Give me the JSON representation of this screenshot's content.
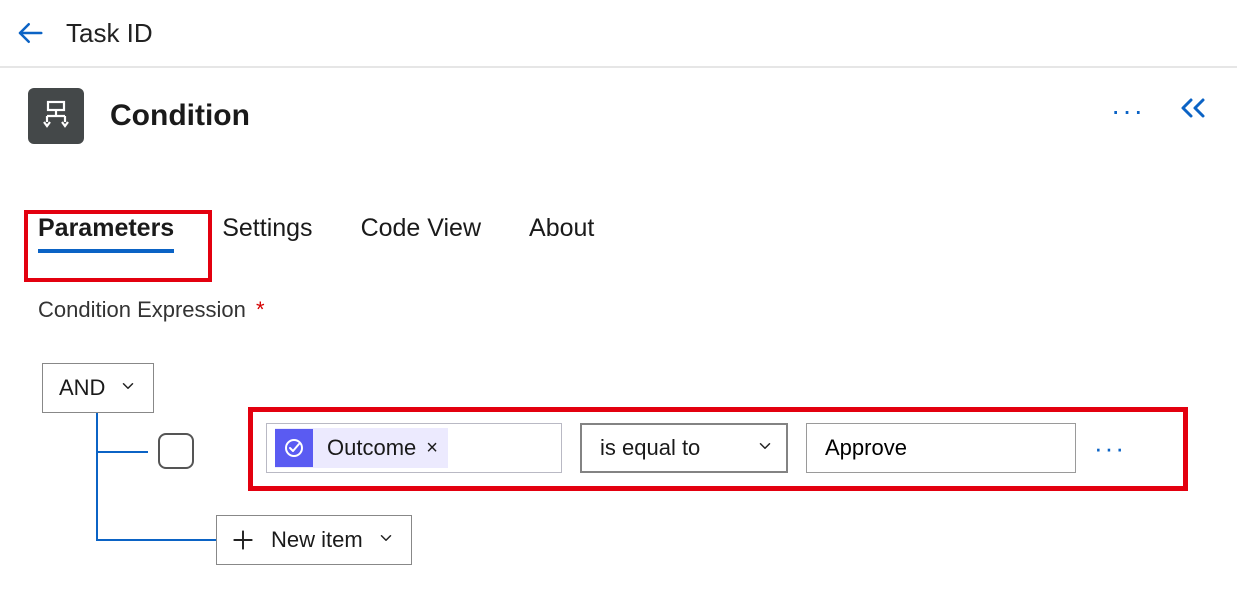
{
  "header": {
    "title": "Task ID"
  },
  "card": {
    "title": "Condition"
  },
  "tabs": [
    {
      "label": "Parameters",
      "active": true
    },
    {
      "label": "Settings",
      "active": false
    },
    {
      "label": "Code View",
      "active": false
    },
    {
      "label": "About",
      "active": false
    }
  ],
  "section": {
    "label": "Condition Expression",
    "required": "*"
  },
  "builder": {
    "group_operator": "AND",
    "row": {
      "field_token": "Outcome",
      "operator": "is equal to",
      "value": "Approve"
    },
    "new_item_label": "New item"
  },
  "colors": {
    "accent": "#0b63c5",
    "highlight": "#e3000f",
    "token_bg": "#eceafe",
    "token_icon_bg": "#5a5bf2",
    "card_icon_bg": "#444849"
  }
}
